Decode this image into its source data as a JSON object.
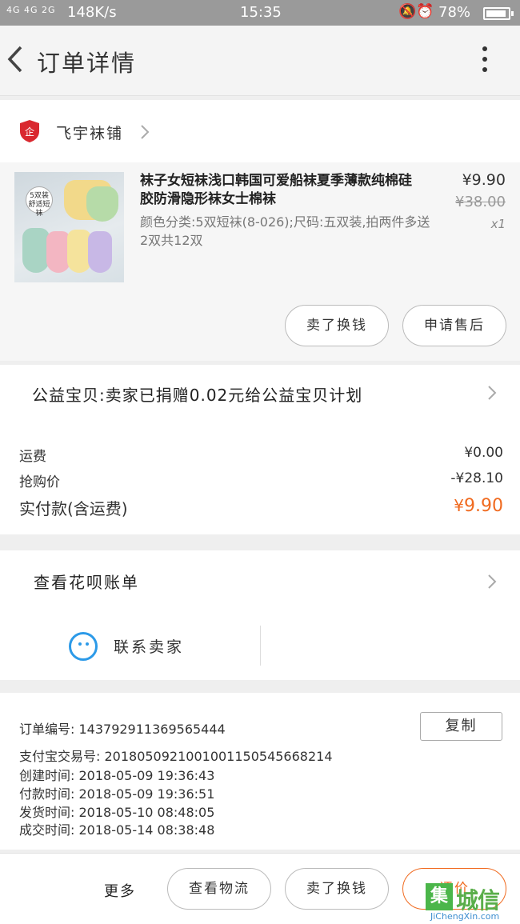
{
  "status_bar": {
    "signal": "4G 4G  2G",
    "speed": "148K/s",
    "time": "15:35",
    "battery": "78%",
    "icons": [
      "bell-off-icon",
      "alarm-icon"
    ]
  },
  "header": {
    "title": "订单详情"
  },
  "store": {
    "name": "飞宇袜铺"
  },
  "product": {
    "thumb_tag": "5双装 舒适短袜",
    "title": "袜子女短袜浅口韩国可爱船袜夏季薄款纯棉硅胶防滑隐形袜女士棉袜",
    "spec": "颜色分类:5双短袜(8-026);尺码:五双装,拍两件多送2双共12双",
    "price": "¥9.90",
    "original_price": "¥38.00",
    "quantity": "x1",
    "buttons": {
      "sell": "卖了换钱",
      "after_sale": "申请售后"
    }
  },
  "charity": {
    "text": "公益宝贝:卖家已捐赠0.02元给公益宝贝计划"
  },
  "fees": {
    "shipping_label": "运费",
    "shipping_value": "¥0.00",
    "rush_label": "抢购价",
    "rush_value": "-¥28.10",
    "paid_label": "实付款(含运费)",
    "paid_symbol": "¥",
    "paid_value": "9.90"
  },
  "huabei": {
    "text": "查看花呗账单"
  },
  "contact": {
    "text": "联系卖家"
  },
  "order_info": {
    "order_no": "订单编号:  143792911369565444",
    "copy_label": "复制",
    "alipay_no": "支付宝交易号:  2018050921001001150545668214",
    "created": "创建时间:  2018-05-09 19:36:43",
    "paid": "付款时间:  2018-05-09 19:36:51",
    "shipped": "发货时间:  2018-05-10 08:48:05",
    "completed": "成交时间:  2018-05-14 08:38:48"
  },
  "bottom_bar": {
    "more": "更多",
    "logistics": "查看物流",
    "sell": "卖了换钱",
    "evaluate": "评价"
  },
  "watermark": {
    "box": "集",
    "text": "城信",
    "url": "JiChengXin.com"
  },
  "colors": {
    "accent_orange": "#f06a1f",
    "contact_blue": "#2c9ae8",
    "store_red": "#d9282f"
  }
}
